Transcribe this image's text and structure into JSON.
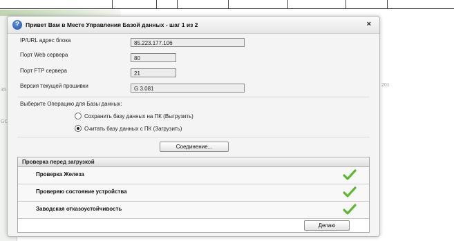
{
  "dialog": {
    "title": "Привет Вам в Месте Управления Базой данных - шаг 1 из 2",
    "help_icon": "help-icon",
    "close_glyph": "×"
  },
  "fields": [
    {
      "label": "IP/URL адрес блока",
      "value": "85.223.177.106"
    },
    {
      "label": "Порт Web сервера",
      "value": "80"
    },
    {
      "label": "Порт FTP сервера",
      "value": "21"
    },
    {
      "label": "Версия текущей прошивки",
      "value": "G 3.081"
    }
  ],
  "operation": {
    "label": "Выберите Операцию для Базы данных:",
    "options": [
      {
        "label": "Сохранить базу данных на ПК (Выгрузить)",
        "selected": false
      },
      {
        "label": "Считать базу данных с ПК (Загрузить)",
        "selected": true
      }
    ]
  },
  "connect_button": "Соединение...",
  "checks": {
    "title": "Проверка перед загрузкой",
    "items": [
      {
        "label": "Проверка Железа",
        "status_icon": "checkmark-icon"
      },
      {
        "label": "Проверяю состояние устройства",
        "status_icon": "checkmark-icon"
      },
      {
        "label": "Заводская отказоустойчивость",
        "status_icon": "checkmark-icon"
      }
    ]
  },
  "action_button": "Делаю",
  "background": {
    "strip_text": "",
    "side_labels": [
      "35",
      "GO"
    ],
    "right_label": "201"
  },
  "colors": {
    "check_green": "#5cb82e",
    "help_blue": "#1e4fb0"
  }
}
